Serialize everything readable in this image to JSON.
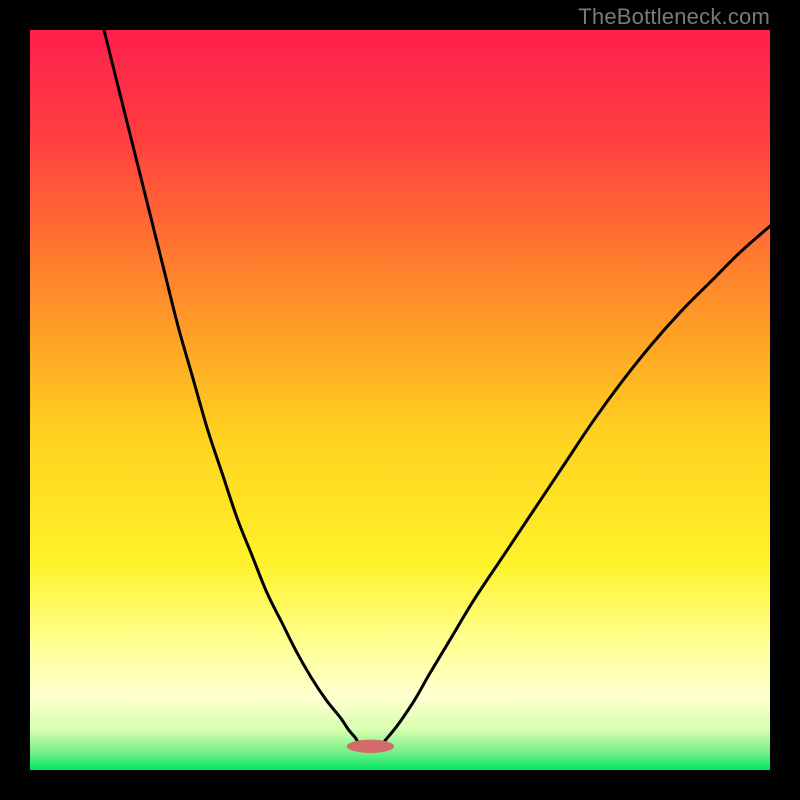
{
  "watermark": "TheBottleneck.com",
  "chart_data": {
    "type": "line",
    "title": "",
    "xlabel": "",
    "ylabel": "",
    "xlim": [
      0,
      100
    ],
    "ylim": [
      0,
      100
    ],
    "grid": false,
    "legend": false,
    "background_gradient_stops": [
      {
        "offset": 0.0,
        "color": "#ff1f4b"
      },
      {
        "offset": 0.15,
        "color": "#ff4040"
      },
      {
        "offset": 0.35,
        "color": "#ff8a2a"
      },
      {
        "offset": 0.55,
        "color": "#ffd21f"
      },
      {
        "offset": 0.72,
        "color": "#fff22a"
      },
      {
        "offset": 0.82,
        "color": "#ffff8a"
      },
      {
        "offset": 0.9,
        "color": "#ffffd0"
      },
      {
        "offset": 0.945,
        "color": "#d8ffb0"
      },
      {
        "offset": 0.975,
        "color": "#7af08a"
      },
      {
        "offset": 1.0,
        "color": "#00e765"
      }
    ],
    "series": [
      {
        "name": "left-curve",
        "x": [
          10,
          12,
          14,
          16,
          18,
          20,
          22,
          24,
          26,
          28,
          30,
          32,
          34,
          36,
          38,
          40,
          42,
          43,
          44,
          44.5
        ],
        "y": [
          100,
          92,
          84,
          76,
          68,
          60,
          53,
          46,
          40,
          34,
          29,
          24,
          20,
          16,
          12.5,
          9.5,
          7,
          5.5,
          4.3,
          3.4
        ]
      },
      {
        "name": "right-curve",
        "x": [
          47.5,
          48,
          49,
          50,
          52,
          54,
          57,
          60,
          64,
          68,
          72,
          76,
          80,
          84,
          88,
          92,
          96,
          100
        ],
        "y": [
          3.4,
          4.0,
          5.2,
          6.5,
          9.5,
          13,
          18,
          23,
          29,
          35,
          41,
          47,
          52.5,
          57.5,
          62,
          66,
          70,
          73.5
        ]
      }
    ],
    "marker": {
      "name": "valley-marker",
      "cx": 46,
      "cy": 3.2,
      "rx": 3.2,
      "ry": 0.9,
      "color": "#d46a6a"
    }
  }
}
